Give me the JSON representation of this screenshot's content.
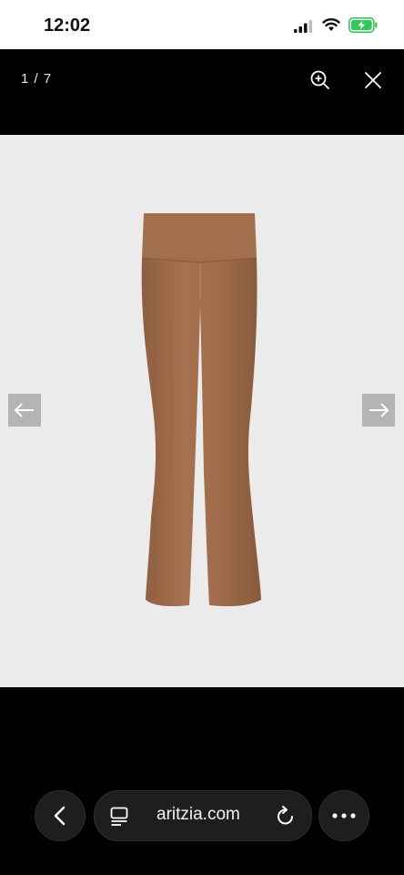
{
  "status_bar": {
    "time": "12:02",
    "icons": [
      "signal-icon",
      "wifi-icon",
      "battery-charging-icon"
    ],
    "battery_color": "#34c759"
  },
  "viewer": {
    "counter": "1 / 7",
    "icons": [
      "zoom-in-icon",
      "close-icon",
      "arrow-left-icon",
      "arrow-right-icon"
    ]
  },
  "product": {
    "image": "brown flared leggings",
    "color": "#9c6a49"
  },
  "browser": {
    "address": "aritzia.com",
    "icons": [
      "chevron-left-icon",
      "reader-mode-icon",
      "reload-icon",
      "more-icon"
    ]
  }
}
